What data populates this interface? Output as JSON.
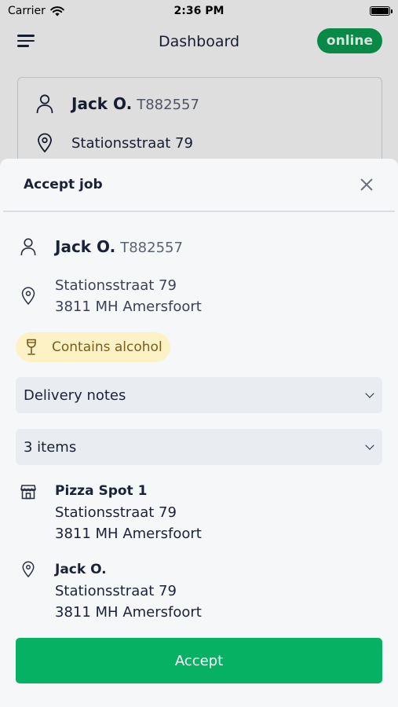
{
  "status_bar": {
    "carrier": "Carrier",
    "time": "2:36 PM",
    "battery_level": 1.0
  },
  "header": {
    "title": "Dashboard",
    "status": "online"
  },
  "background_card": {
    "name": "Jack O.",
    "code": "T882557",
    "address_line1": "Stationsstraat 79"
  },
  "modal": {
    "title": "Accept job",
    "customer": {
      "name": "Jack O.",
      "code": "T882557",
      "address_line1": "Stationsstraat 79",
      "address_line2": "3811 MH Amersfoort"
    },
    "alcohol_label": "Contains alcohol",
    "delivery_notes_label": "Delivery notes",
    "items_label": "3 items",
    "pickup": {
      "name": "Pizza Spot 1",
      "address_line1": "Stationsstraat 79",
      "address_line2": "3811 MH Amersfoort"
    },
    "dropoff": {
      "name": "Jack O.",
      "address_line1": "Stationsstraat 79",
      "address_line2": "3811 MH Amersfoort"
    },
    "accept_label": "Accept"
  },
  "colors": {
    "accent": "#06b163",
    "online": "#0a9e52",
    "alcohol_bg": "#fcf2c6"
  },
  "icons": [
    "wifi-icon",
    "battery-icon",
    "menu-icon",
    "person-icon",
    "location-pin-icon",
    "wine-glass-icon",
    "chevron-down-icon",
    "store-icon",
    "close-icon"
  ]
}
